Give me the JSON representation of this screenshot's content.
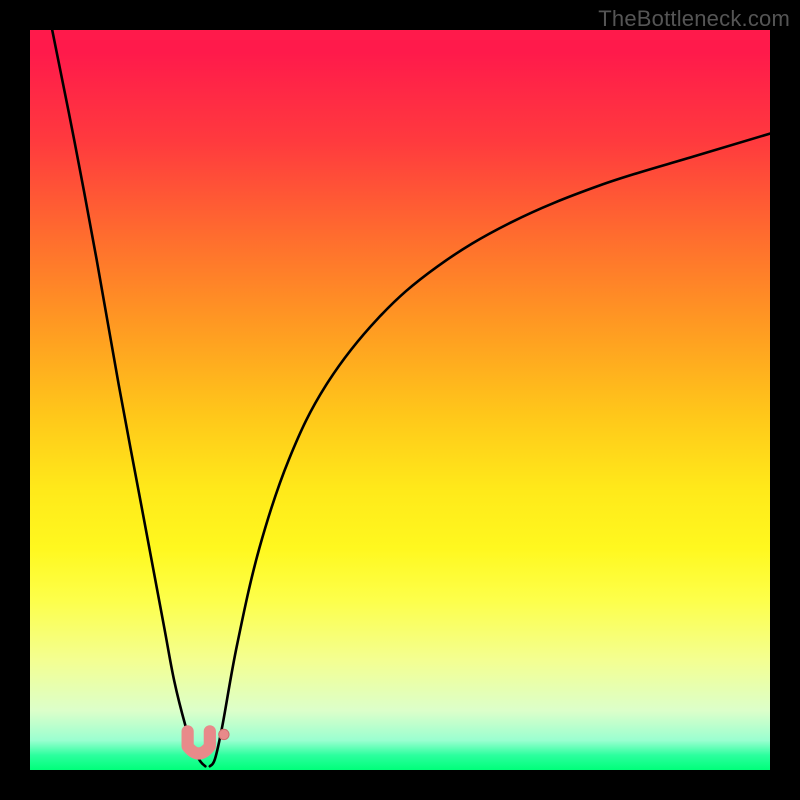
{
  "attribution": "TheBottleneck.com",
  "colors": {
    "page_bg": "#000000",
    "gradient_top": "#ff1a4b",
    "gradient_bottom": "#00ff7a",
    "curve_stroke": "#000000",
    "marker_fill": "#e88a8a",
    "marker_stroke": "#cc6f6f"
  },
  "chart_data": {
    "type": "line",
    "title": "",
    "xlabel": "",
    "ylabel": "",
    "xlim": [
      0,
      100
    ],
    "ylim": [
      0,
      100
    ],
    "grid": false,
    "legend": false,
    "series": [
      {
        "name": "curve-left",
        "x": [
          3,
          6,
          9,
          12,
          15,
          18,
          19.5,
          21,
          22,
          23,
          23.7
        ],
        "values": [
          100,
          85,
          69,
          52,
          36,
          20,
          12,
          6,
          3,
          1.2,
          0.5
        ]
      },
      {
        "name": "curve-right",
        "x": [
          24.3,
          25,
          26,
          28,
          31,
          35,
          40,
          47,
          55,
          65,
          77,
          90,
          100
        ],
        "values": [
          0.5,
          1.5,
          6,
          17,
          30,
          42,
          52,
          61,
          68,
          74,
          79,
          83,
          86
        ]
      }
    ],
    "markers": [
      {
        "name": "u-marker",
        "shape": "u",
        "x": 22.8,
        "y": 2.0,
        "size": 3.0
      },
      {
        "name": "dot-marker",
        "shape": "dot",
        "x": 26.2,
        "y": 4.8,
        "size": 1.4
      }
    ]
  }
}
